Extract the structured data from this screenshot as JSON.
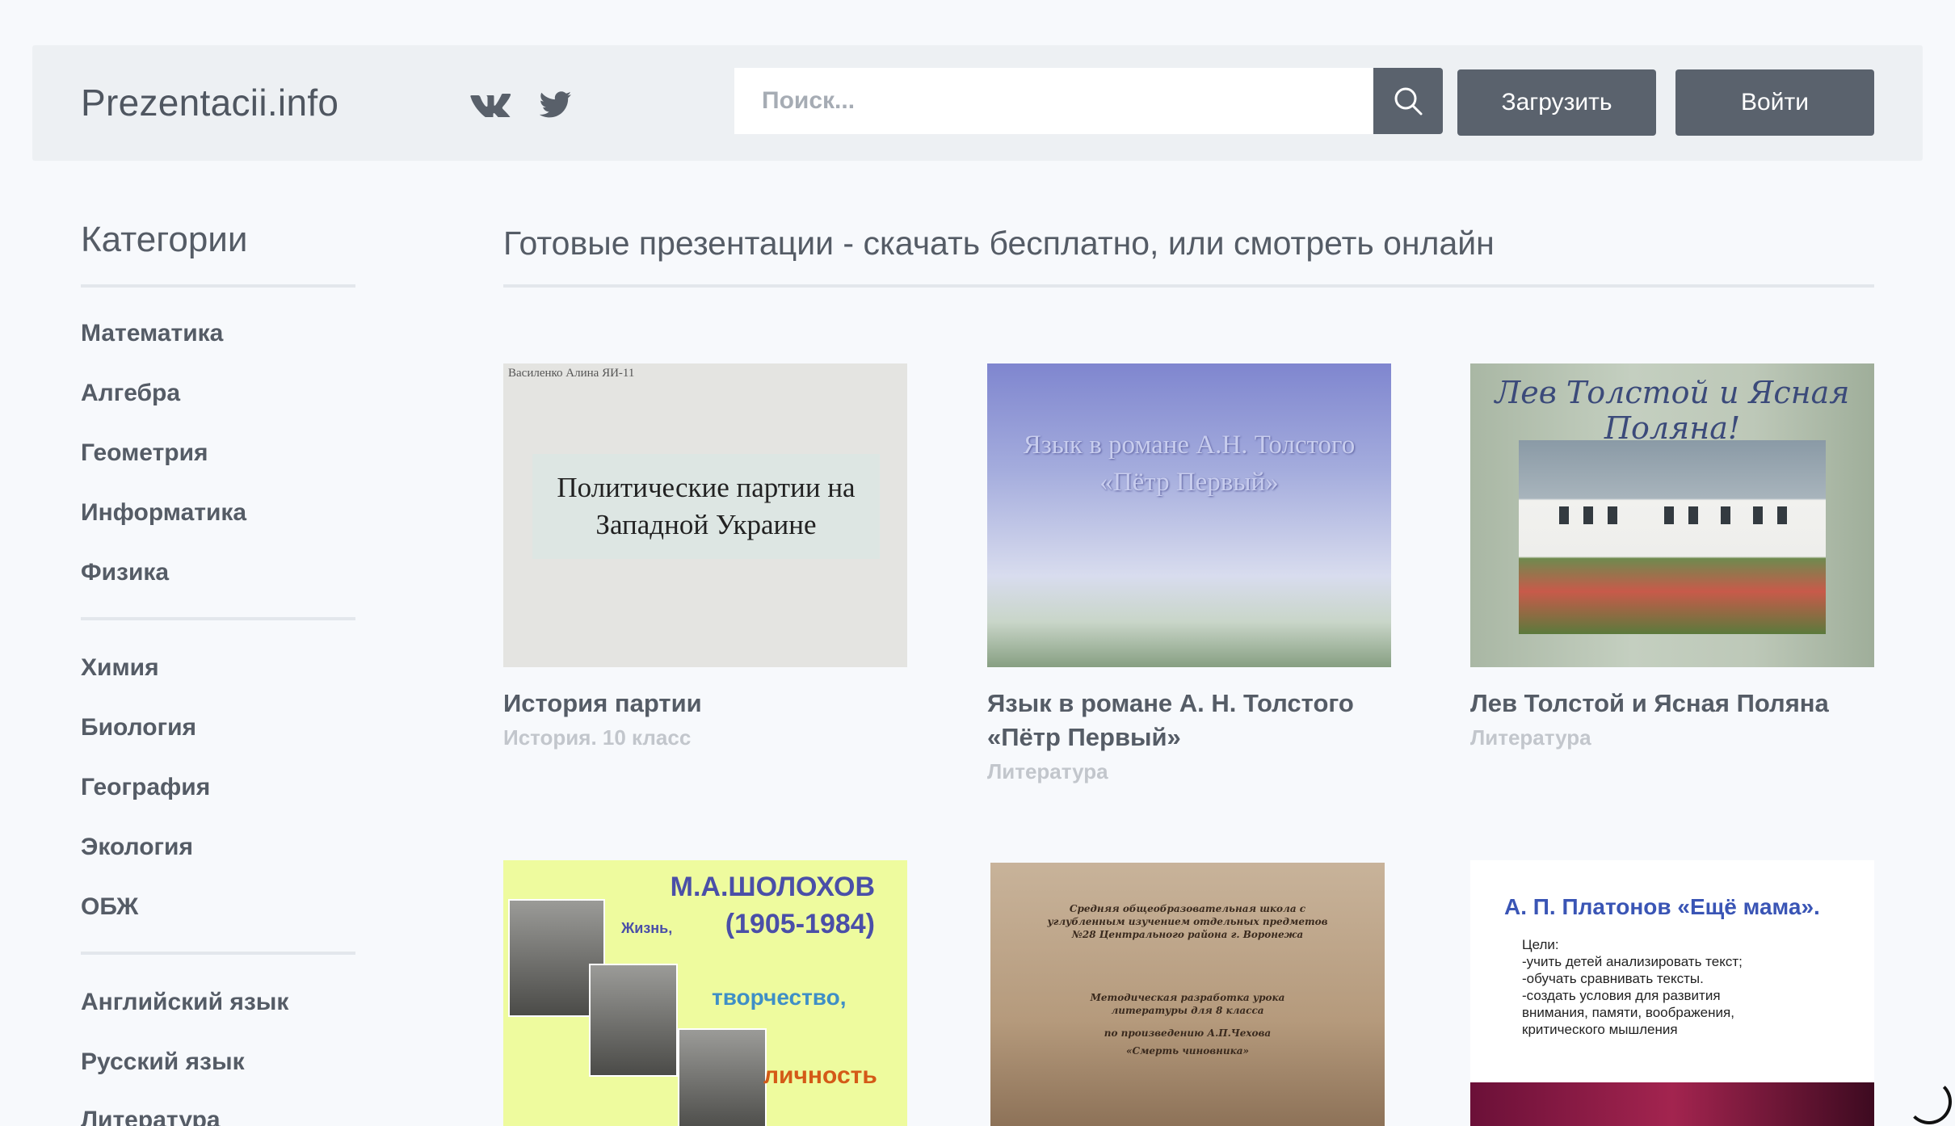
{
  "header": {
    "logo": "Prezentacii.info",
    "search_placeholder": "Поиск...",
    "upload_label": "Загрузить",
    "login_label": "Войти",
    "social": [
      "vk-icon",
      "twitter-icon"
    ]
  },
  "sidebar": {
    "title": "Категории",
    "groups": [
      [
        "Математика",
        "Алгебра",
        "Геометрия",
        "Информатика",
        "Физика"
      ],
      [
        "Химия",
        "Биология",
        "География",
        "Экология",
        "ОБЖ"
      ],
      [
        "Английский язык",
        "Русский язык",
        "Литература"
      ]
    ]
  },
  "main": {
    "title": "Готовые презентации - скачать бесплатно, или смотреть онлайн",
    "cards": [
      {
        "title": "История партии",
        "category": "История. 10 класс",
        "thumb": {
          "author": "Василенко Алина ЯИ-11",
          "line1": "Политические партии на",
          "line2": "Западной Украине"
        }
      },
      {
        "title_line1": "Язык в романе А. Н. Толстого",
        "title_line2": "«Пётр Первый»",
        "category": "Литература",
        "thumb": {
          "line1": "Язык в романе А.Н. Толстого",
          "line2": "«Пётр Первый»"
        }
      },
      {
        "title": "Лев Толстой и Ясная Поляна",
        "category": "Литература",
        "thumb": {
          "heading": "Лев Толстой и Ясная Поляна!"
        }
      },
      {
        "thumb": {
          "name": "М.А.ШОЛОХОВ",
          "years": "(1905-1984)",
          "w1": "Жизнь,",
          "w2": "творчество,",
          "w3": "личность"
        }
      },
      {
        "thumb": {
          "l1": "Средняя общеобразовательная школа с",
          "l2": "углубленным изучением отдельных предметов",
          "l3": "№28 Центрального района г. Воронежа",
          "l4": "Методическая разработка урока",
          "l5": "литературы для 8 класса",
          "l6": "по произведению А.П.Чехова",
          "l7": "«Смерть чиновника»"
        }
      },
      {
        "thumb": {
          "head": "А. П. Платонов «Ещё мама».",
          "l0": "Цели:",
          "l1": "-учить детей анализировать текст;",
          "l2": "-обучать сравнивать тексты.",
          "l3": "-создать условия для развития",
          "l4": "внимания, памяти, воображения,",
          "l5": "критического мышления"
        }
      }
    ]
  }
}
